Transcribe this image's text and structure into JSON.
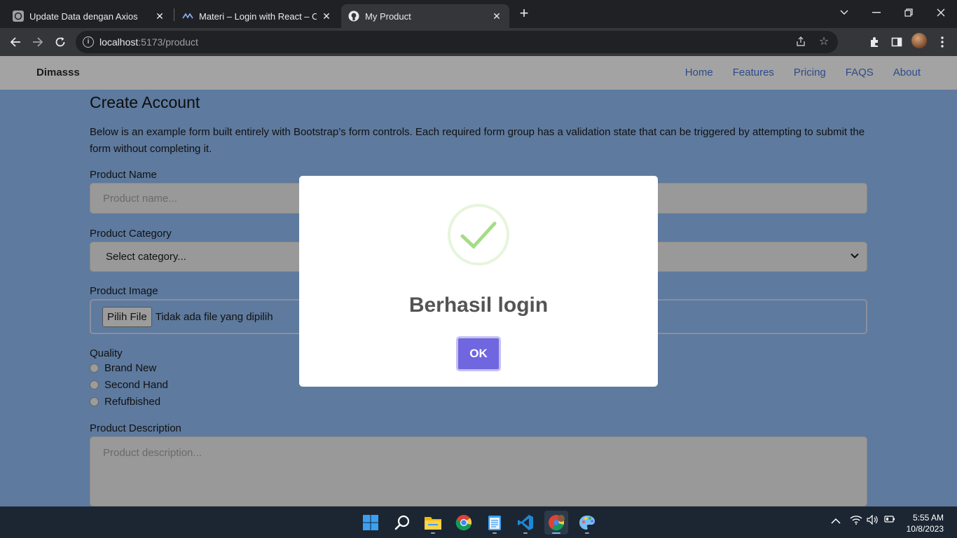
{
  "browser": {
    "tabs": [
      {
        "title": "Update Data dengan Axios",
        "icon": "chatgpt-icon",
        "active": false
      },
      {
        "title": "Materi – Login with React – ONE",
        "icon": "site-logo-icon",
        "active": false
      },
      {
        "title": "My Product",
        "icon": "github-icon",
        "active": true
      }
    ],
    "url_host": "localhost",
    "url_path": ":5173/product"
  },
  "navbar": {
    "brand": "Dimasss",
    "links": [
      "Home",
      "Features",
      "Pricing",
      "FAQS",
      "About"
    ]
  },
  "form": {
    "title": "Create Account",
    "description": "Below is an example form built entirely with Bootstrap’s form controls. Each required form group has a validation state that can be triggered by attempting to submit the form without completing it.",
    "product_name_label": "Product Name",
    "product_name_placeholder": "Product name...",
    "category_label": "Product Category",
    "category_selected": "Select category...",
    "image_label": "Product Image",
    "file_button": "Pilih File",
    "file_status": "Tidak ada file yang dipilih",
    "quality_label": "Quality",
    "quality_options": [
      "Brand New",
      "Second Hand",
      "Refufbished"
    ],
    "description_label": "Product Description",
    "description_placeholder": "Product description..."
  },
  "modal": {
    "title": "Berhasil login",
    "ok_label": "OK",
    "icon": "success-check-icon"
  },
  "taskbar": {
    "apps": [
      "windows-start-icon",
      "search-icon",
      "file-explorer-icon",
      "chrome-icon",
      "notepad-icon",
      "vscode-icon",
      "chrome-profile-icon",
      "paint-icon"
    ],
    "time": "5:55 AM",
    "date": "10/8/2023"
  },
  "colors": {
    "page_bg": "#5e7a9e",
    "navbar_bg": "#a3a3a3",
    "ok_button": "#7066e0",
    "success_green": "#a5dc86"
  }
}
